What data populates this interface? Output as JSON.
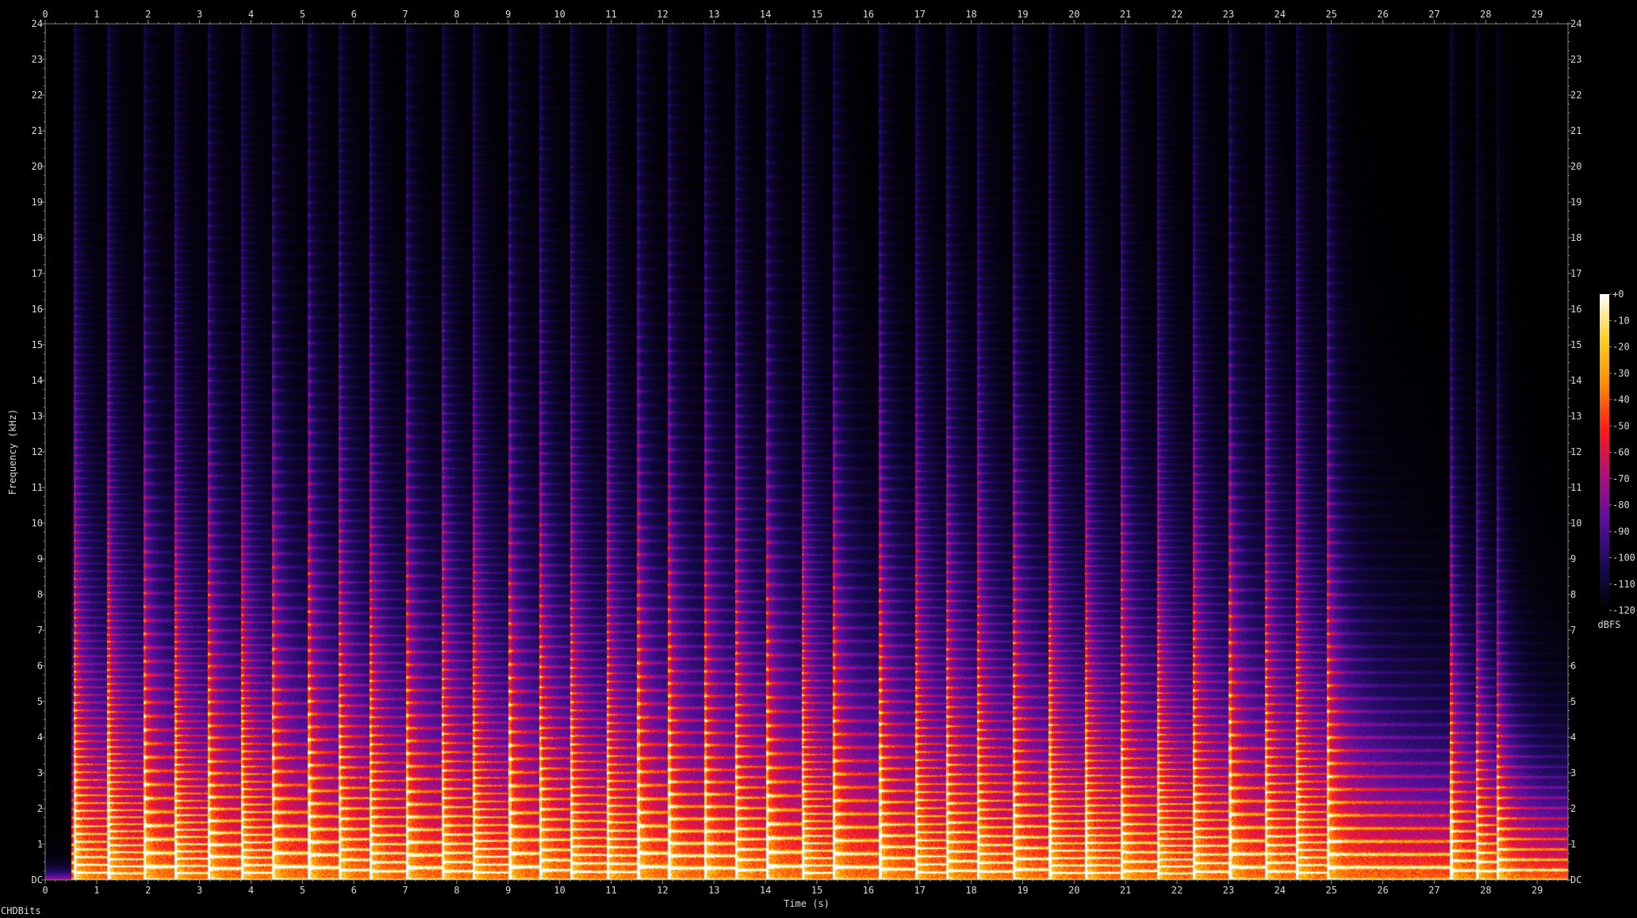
{
  "chart_data": {
    "type": "heatmap",
    "title": "",
    "xlabel": "Time (s)",
    "ylabel": "Frequency (kHz)",
    "xlim": [
      0,
      29.6
    ],
    "ylim": [
      0,
      24
    ],
    "x_ticks": [
      "0",
      "1",
      "2",
      "3",
      "4",
      "5",
      "6",
      "7",
      "8",
      "9",
      "10",
      "11",
      "12",
      "13",
      "14",
      "15",
      "16",
      "17",
      "18",
      "19",
      "20",
      "21",
      "22",
      "23",
      "24",
      "25",
      "26",
      "27",
      "28",
      "29"
    ],
    "y_ticks": [
      "DC",
      "1",
      "2",
      "3",
      "4",
      "5",
      "6",
      "7",
      "8",
      "9",
      "10",
      "11",
      "12",
      "13",
      "14",
      "15",
      "16",
      "17",
      "18",
      "19",
      "20",
      "21",
      "22",
      "23",
      "24"
    ],
    "colorbar": {
      "label": "dBFS",
      "range": [
        -120,
        0
      ],
      "ticks": [
        "+0",
        "-10",
        "-20",
        "-30",
        "-40",
        "-50",
        "-60",
        "-70",
        "-80",
        "-90",
        "-100",
        "-110",
        "-120"
      ]
    },
    "note_onsets_s": [
      0.55,
      1.2,
      1.9,
      2.5,
      3.15,
      3.8,
      4.4,
      5.1,
      5.7,
      6.3,
      7.0,
      7.7,
      8.3,
      9.0,
      9.6,
      10.2,
      10.9,
      11.5,
      12.1,
      12.8,
      13.4,
      14.0,
      14.7,
      15.3,
      16.2,
      16.9,
      17.5,
      18.1,
      18.8,
      19.5,
      20.2,
      20.9,
      21.6,
      22.3,
      23.0,
      23.7,
      24.3,
      24.9,
      27.3,
      27.8,
      28.2
    ],
    "palette": [
      "#000000",
      "#1a0a55",
      "#5a0fa0",
      "#b0107a",
      "#ff1a1a",
      "#ff8a00",
      "#ffd020",
      "#ffffff"
    ]
  },
  "footer": {
    "text": "CHDBits"
  }
}
